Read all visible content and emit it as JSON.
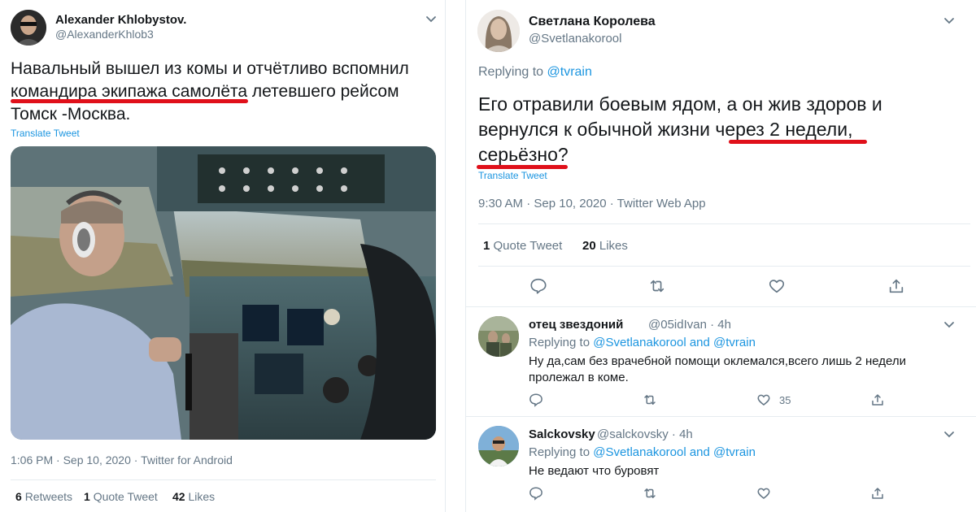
{
  "left_tweet": {
    "author_name": "Alexander Khlobystov.",
    "author_handle": "@AlexanderKhlob3",
    "text_line1": "Навальный вышел из комы и отчётливо вспомнил",
    "text_line2_highlight": "командира экипажа самолёта",
    "text_line2_rest": " летевшего рейсом",
    "text_line3": "Томск -Москва.",
    "translate": "Translate Tweet",
    "timestamp": "1:06 PM · Sep 10, 2020 · Twitter for Android",
    "stats": {
      "retweets_count": "6",
      "retweets_label": "Retweets",
      "quotes_count": "1",
      "quotes_label": "Quote Tweet",
      "likes_count": "42",
      "likes_label": "Likes"
    }
  },
  "right_tweet": {
    "author_name": "Светлана Королева",
    "author_handle": "@Svetlanakorool",
    "replying_prefix": "Replying to ",
    "replying_to": "@tvrain",
    "text_line1": "Его отравили боевым ядом, а он жив здоров и",
    "text_line2_plain": "вернулся к обычной жизни ",
    "text_line2_highlight": "через 2 недели,",
    "text_line3_highlight": "серьёзно?",
    "translate": "Translate Tweet",
    "timestamp": "9:30 AM · Sep 10, 2020 · Twitter Web App",
    "stats": {
      "quotes_count": "1",
      "quotes_label": "Quote Tweet",
      "likes_count": "20",
      "likes_label": "Likes"
    }
  },
  "replies": [
    {
      "author_name": "отец звездоний",
      "author_handle": "@05idIvan",
      "time": "· 4h",
      "replying_prefix": "Replying to ",
      "replying_to": "@Svetlanakorool and @tvrain",
      "text_line1": "Ну да,сам без врачебной помощи оклемался,всего лишь 2 недели",
      "text_line2": "пролежал в коме.",
      "likes": "35"
    },
    {
      "author_name": "Salckovsky",
      "author_handle": "@salckovsky",
      "time": "· 4h",
      "replying_prefix": "Replying to ",
      "replying_to": "@Svetlanakorool and @tvrain",
      "text_line1": "Не ведают что буровят"
    }
  ],
  "colors": {
    "accent": "#1b95e0",
    "text": "#14171a",
    "muted": "#657786",
    "divider": "#e6ecf0",
    "highlight_underline": "#e0101a"
  },
  "icons": [
    "chevron-down-icon",
    "reply-icon",
    "retweet-icon",
    "like-icon",
    "share-icon"
  ]
}
